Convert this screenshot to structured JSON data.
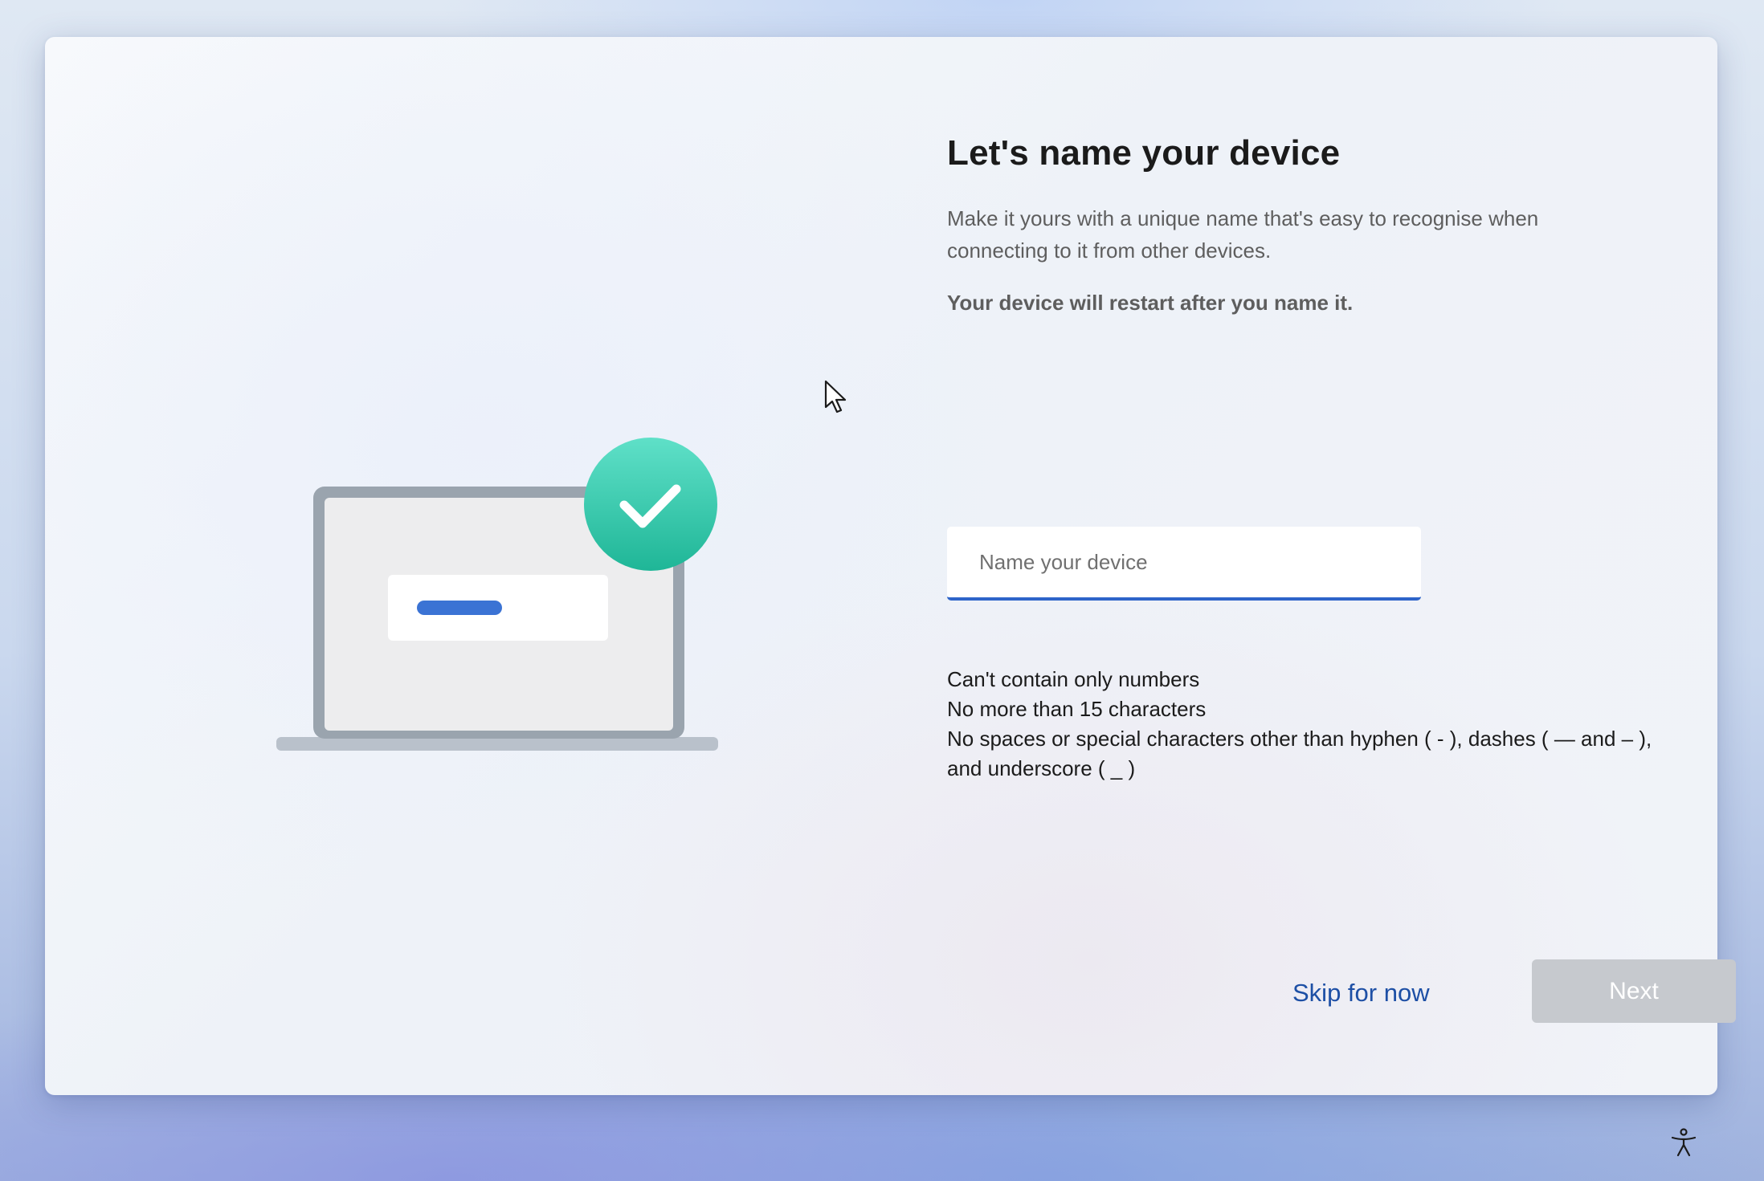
{
  "page": {
    "title": "Let's name your device",
    "description": "Make it yours with a unique name that's easy to recognise when connecting to it from other devices.",
    "notice": "Your device will restart after you name it."
  },
  "device_name": {
    "value": "",
    "placeholder": "Name your device"
  },
  "rules": [
    "Can't contain only numbers",
    "No more than 15 characters",
    "No spaces or special characters other than hyphen ( - ), dashes ( — and – ), and underscore ( _ )"
  ],
  "actions": {
    "skip_label": "Skip for now",
    "next_label": "Next",
    "next_enabled": false
  },
  "icons": {
    "illustration": "laptop-checkmark-illustration",
    "cursor": "mouse-pointer-icon",
    "accessibility": "accessibility-icon"
  },
  "colors": {
    "accent": "#2e64c9",
    "link": "#1d4fa5",
    "check_badge": "#2ec4a6",
    "disabled_button": "#c6c9ce"
  }
}
